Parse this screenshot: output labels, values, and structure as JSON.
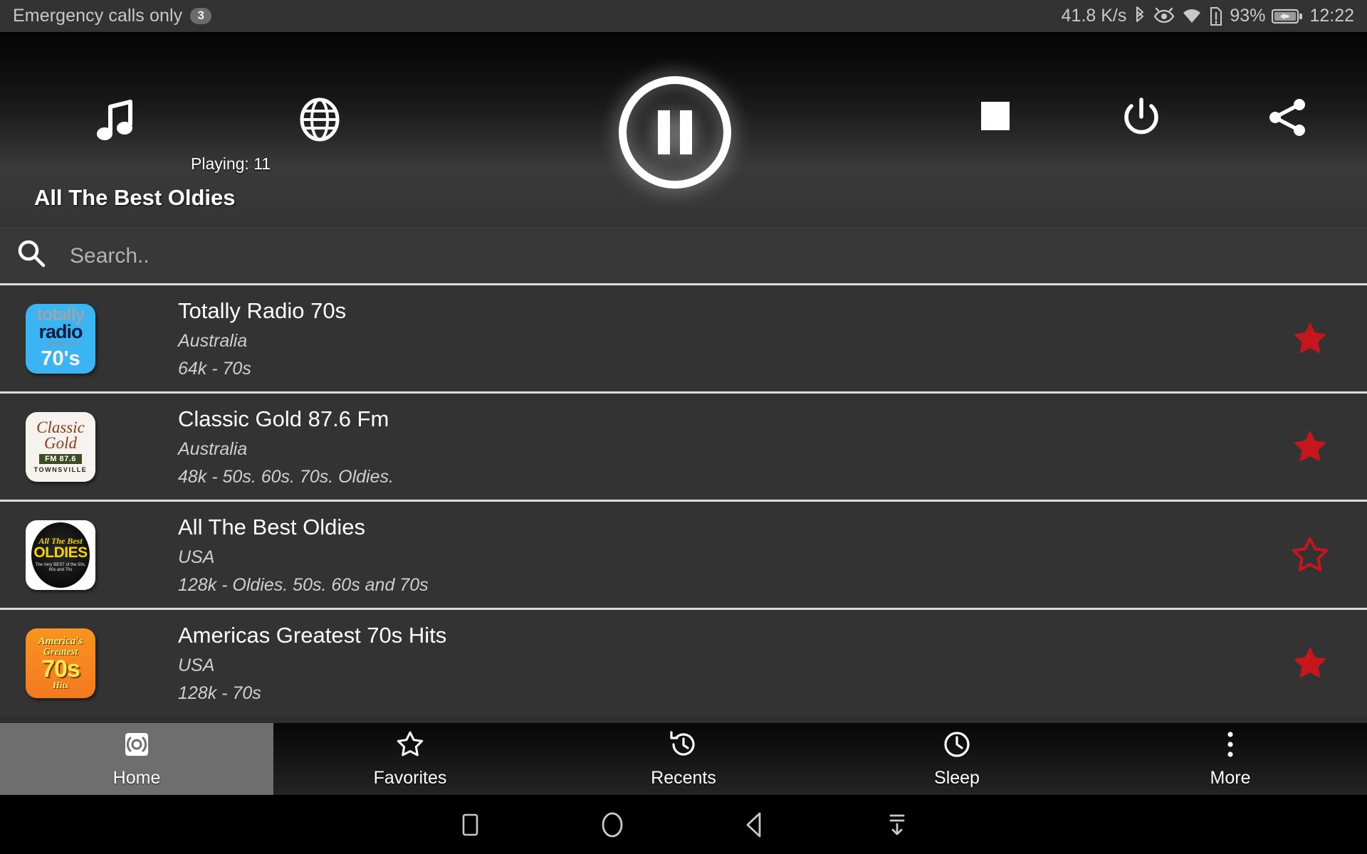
{
  "status_bar": {
    "carrier_text": "Emergency calls only",
    "notification_count": "3",
    "network_speed": "41.8 K/s",
    "battery_percent": "93%",
    "clock": "12:22",
    "icons": [
      "bluetooth-icon",
      "eye-icon",
      "wifi-icon",
      "sim-alert-icon",
      "battery-charging-icon"
    ]
  },
  "player": {
    "music_icon": "music-note-icon",
    "globe_icon": "globe-icon",
    "playing_label": "Playing: 11",
    "playpause_icon": "pause-icon",
    "stop_icon": "stop-icon",
    "power_icon": "power-icon",
    "share_icon": "share-icon",
    "now_playing_title": "All The Best Oldies"
  },
  "search": {
    "icon": "search-icon",
    "placeholder": "Search..",
    "value": ""
  },
  "stations": [
    {
      "name": "Totally Radio 70s",
      "country": "Australia",
      "info": "64k - 70s",
      "favorite": true,
      "logo": "totally-radio-70s-logo",
      "logo_text": {
        "l1": "totally",
        "l2": "radio",
        "l3": ".com.au",
        "l4": "70's"
      }
    },
    {
      "name": "Classic Gold 87.6 Fm",
      "country": "Australia",
      "info": "48k - 50s. 60s. 70s. Oldies.",
      "favorite": true,
      "logo": "classic-gold-logo",
      "logo_text": {
        "l1": "Classic",
        "l2": "Gold",
        "l3": "FM 87.6",
        "l4": "TOWNSVILLE"
      }
    },
    {
      "name": "All The Best Oldies",
      "country": "USA",
      "info": "128k - Oldies. 50s. 60s and 70s",
      "favorite": false,
      "logo": "all-the-best-oldies-logo",
      "logo_text": {
        "l1": "All The Best",
        "l2": "OLDIES",
        "l3": "The Very BEST of the 50s, 60s and 70s"
      }
    },
    {
      "name": "Americas Greatest 70s Hits",
      "country": "USA",
      "info": "128k - 70s",
      "favorite": true,
      "logo": "americas-greatest-70s-hits-logo",
      "logo_text": {
        "l1": "America's",
        "l2": "Greatest",
        "l3": "70s",
        "l4": "Hits"
      }
    }
  ],
  "bottom_tabs": [
    {
      "label": "Home",
      "icon": "broadcast-icon",
      "active": true
    },
    {
      "label": "Favorites",
      "icon": "star-outline-icon",
      "active": false
    },
    {
      "label": "Recents",
      "icon": "history-icon",
      "active": false
    },
    {
      "label": "Sleep",
      "icon": "clock-icon",
      "active": false
    },
    {
      "label": "More",
      "icon": "more-vertical-icon",
      "active": false
    }
  ],
  "android_nav": [
    {
      "icon": "recents-square-icon"
    },
    {
      "icon": "home-circle-icon"
    },
    {
      "icon": "back-triangle-icon"
    },
    {
      "icon": "hide-keyboard-icon"
    }
  ],
  "colors": {
    "favorite_star": "#c4161c",
    "background": "#333333",
    "divider": "#dcdcdc",
    "active_tab": "#6e6e6e"
  }
}
